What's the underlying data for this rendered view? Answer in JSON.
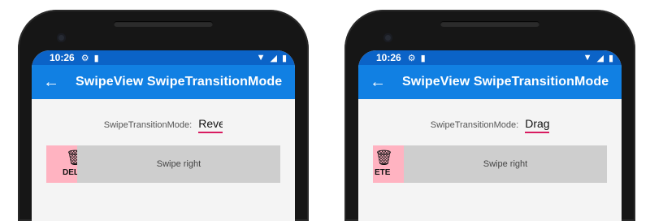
{
  "screens": [
    {
      "status": {
        "time": "10:26"
      },
      "appbar": {
        "title": "SwipeView SwipeTransitionMode"
      },
      "mode": {
        "label": "SwipeTransitionMode:",
        "value": "Reve"
      },
      "swipe": {
        "delete_label": "DEL",
        "content_text": "Swipe right"
      }
    },
    {
      "status": {
        "time": "10:26"
      },
      "appbar": {
        "title": "SwipeView SwipeTransitionMode"
      },
      "mode": {
        "label": "SwipeTransitionMode:",
        "value": "Drag"
      },
      "swipe": {
        "delete_label": "ETE",
        "content_text": "Swipe right"
      }
    }
  ],
  "colors": {
    "statusbar": "#0b63c7",
    "appbar": "#1180e3",
    "swipe_content": "#cecece",
    "delete_item": "#ffb3c1",
    "picker_underline": "#d81b60"
  },
  "icons": {
    "back": "arrow-left-icon",
    "settings": "gear-icon",
    "sd_card": "sd-card-icon",
    "wifi": "wifi-icon",
    "signal": "signal-icon",
    "battery": "battery-icon",
    "delete": "trash-icon"
  }
}
